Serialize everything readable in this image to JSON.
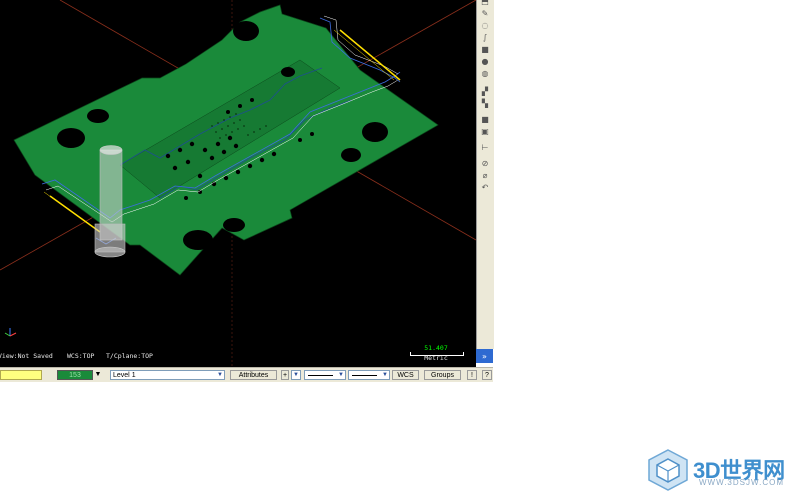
{
  "viewport": {
    "background": "#000000",
    "part_color": "#1a8a3a",
    "status_items": {
      "view": "View:Not Saved",
      "wcs": "WCS:TOP",
      "tplane": "T/Cplane:TOP"
    },
    "scale": {
      "value": "51.407",
      "unit": "Metric"
    }
  },
  "right_toolbar": {
    "icons": [
      "rotate-icon",
      "pencil-icon",
      "circle-arc-icon",
      "curve-icon",
      "solid-box-icon",
      "sphere-icon",
      "globe-icon",
      "chamfer-icon",
      "grid-icon",
      "block-icon",
      "save-icon",
      "dimension-icon",
      "ruler-icon",
      "no-entry-icon",
      "brush-icon",
      "undo-icon"
    ],
    "scroll_glyph": "»"
  },
  "statusbar": {
    "color_value": "153",
    "level_label": "Level",
    "level_value": "1",
    "attributes_label": "Attributes",
    "wcs_label": "WCS",
    "groups_label": "Groups",
    "help_label": "?"
  },
  "watermark": {
    "brand": "3D世界网",
    "url": "WWW.3DSJW.COM"
  }
}
